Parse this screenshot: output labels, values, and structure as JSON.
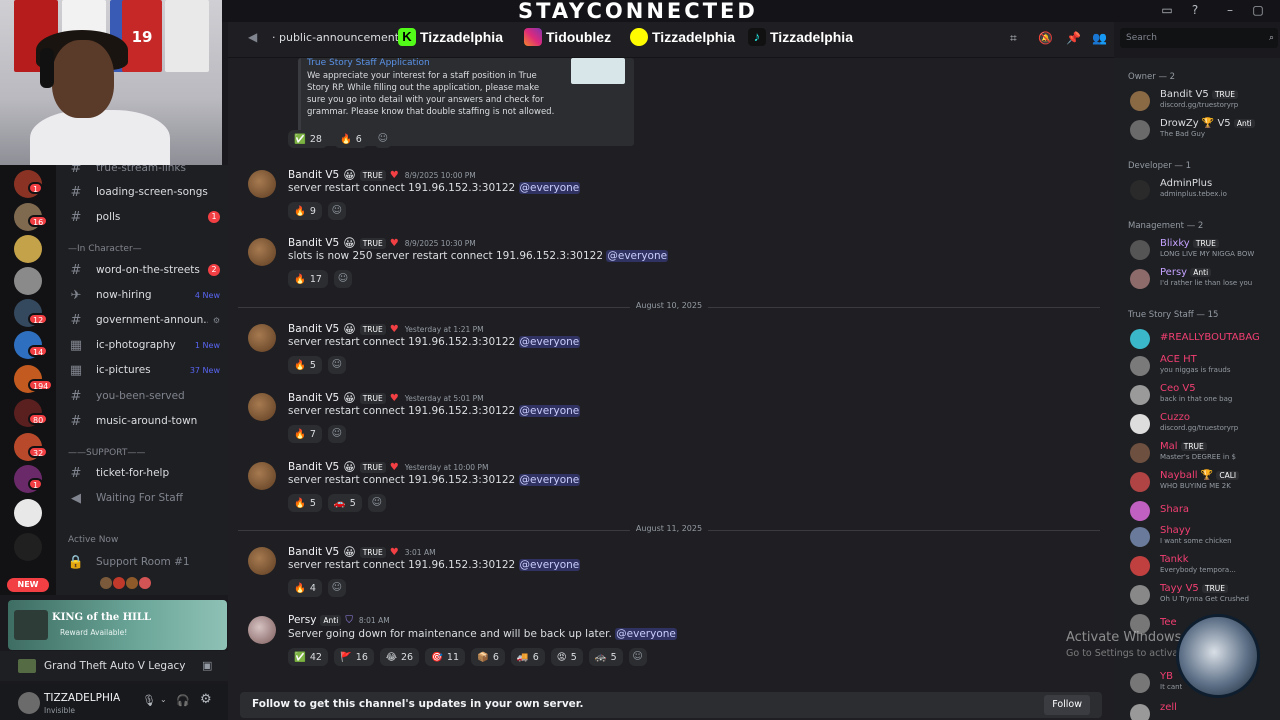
{
  "overlay": {
    "brand_title": "STAYCONNECTED",
    "jersey_numbers": [
      "",
      "",
      "",
      "19",
      ""
    ]
  },
  "server_rail": {
    "badges": [
      "1",
      "16",
      "",
      "",
      "12",
      "14",
      "194",
      "80",
      "32",
      "1"
    ],
    "new_pill": "NEW"
  },
  "channels": {
    "top_partial": "true-stream-links",
    "items": [
      {
        "name": "loading-screen-songs",
        "badge": "",
        "new": ""
      },
      {
        "name": "polls",
        "badge": "1",
        "new": ""
      }
    ],
    "category_in_character": "In Character",
    "in_character": [
      {
        "name": "word-on-the-streets",
        "badge": "2",
        "new": ""
      },
      {
        "name": "now-hiring",
        "badge": "",
        "new": "4 New"
      },
      {
        "name": "government-announ...",
        "badge": "",
        "new": ""
      },
      {
        "name": "ic-photography",
        "badge": "",
        "new": "1 New"
      },
      {
        "name": "ic-pictures",
        "badge": "",
        "new": "37 New"
      },
      {
        "name": "you-been-served",
        "badge": "",
        "new": ""
      },
      {
        "name": "music-around-town",
        "badge": "",
        "new": ""
      }
    ],
    "category_support": "SUPPORT",
    "support": [
      {
        "name": "ticket-for-help"
      },
      {
        "name": "Waiting For Staff"
      }
    ],
    "active_now_label": "Active Now",
    "voice_room": "Support Room #1"
  },
  "activity": {
    "title": "KING of the HILL",
    "subtitle": "Reward Available!",
    "game": "Grand Theft Auto V Legacy",
    "user_name": "TIZZADELPHIA",
    "user_status": "Invisible"
  },
  "header": {
    "channel": "public-announcements",
    "social": [
      {
        "platform": "kick",
        "handle": "Tizzadelphia",
        "color": "#53fc18"
      },
      {
        "platform": "instagram",
        "handle": "Tidoublez",
        "color": "#e1306c"
      },
      {
        "platform": "snapchat",
        "handle": "Tizzadelphia",
        "color": "#fffc00"
      },
      {
        "platform": "tiktok",
        "handle": "Tizzadelphia",
        "color": "#25f4ee"
      }
    ],
    "search_placeholder": "Search"
  },
  "embed": {
    "title": "True Story Staff Application",
    "body": "We appreciate your interest for a staff position in True Story RP. While filling out the application, please make sure you go into detail with your answers and check for grammar. Please know that double staffing is not allowed.",
    "reactions": [
      {
        "emoji": "✅",
        "count": "28"
      },
      {
        "emoji": "🔥",
        "count": "6"
      }
    ]
  },
  "messages": [
    {
      "author": "Bandit V5",
      "tag": "TRUE",
      "time": "8/9/2025 10:00 PM",
      "text": "server restart connect 191.96.152.3:30122",
      "mention": "@everyone",
      "reactions": [
        {
          "emoji": "🔥",
          "count": "9"
        }
      ]
    },
    {
      "author": "Bandit V5",
      "tag": "TRUE",
      "time": "8/9/2025 10:30 PM",
      "text": "slots is now 250 server restart connect 191.96.152.3:30122",
      "mention": "@everyone",
      "reactions": [
        {
          "emoji": "🔥",
          "count": "17"
        }
      ]
    },
    {
      "author": "Bandit V5",
      "tag": "TRUE",
      "time": "Yesterday at 1:21 PM",
      "text": "server restart connect 191.96.152.3:30122",
      "mention": "@everyone",
      "reactions": [
        {
          "emoji": "🔥",
          "count": "5"
        }
      ]
    },
    {
      "author": "Bandit V5",
      "tag": "TRUE",
      "time": "Yesterday at 5:01 PM",
      "text": "server restart connect 191.96.152.3:30122",
      "mention": "@everyone",
      "reactions": [
        {
          "emoji": "🔥",
          "count": "7"
        }
      ]
    },
    {
      "author": "Bandit V5",
      "tag": "TRUE",
      "time": "Yesterday at 10:00 PM",
      "text": "server restart connect 191.96.152.3:30122",
      "mention": "@everyone",
      "reactions": [
        {
          "emoji": "🔥",
          "count": "5"
        },
        {
          "emoji": "🚗",
          "count": "5"
        }
      ]
    },
    {
      "author": "Bandit V5",
      "tag": "TRUE",
      "time": "3:01 AM",
      "text": "server restart connect 191.96.152.3:30122",
      "mention": "@everyone",
      "reactions": [
        {
          "emoji": "🔥",
          "count": "4"
        }
      ]
    },
    {
      "author": "Persy",
      "tag": "Anti",
      "time": "8:01 AM",
      "text": "Server going down for maintenance and will be back up later.",
      "mention": "@everyone",
      "reactions": [
        {
          "emoji": "✅",
          "count": "42"
        },
        {
          "emoji": "🚩",
          "count": "16"
        },
        {
          "emoji": "😂",
          "count": "26"
        },
        {
          "emoji": "🎯",
          "count": "11"
        },
        {
          "emoji": "📦",
          "count": "6"
        },
        {
          "emoji": "🚚",
          "count": "6"
        },
        {
          "emoji": "😡",
          "count": "5"
        },
        {
          "emoji": "🚓",
          "count": "5"
        }
      ]
    }
  ],
  "dividers": [
    "August 10, 2025",
    "August 11, 2025"
  ],
  "follow_bar": {
    "text": "Follow to get this channel's updates in your own server.",
    "button": "Follow"
  },
  "members": {
    "groups": [
      {
        "title": "Owner — 2",
        "members": [
          {
            "name": "Bandit V5",
            "tag": "TRUE",
            "status": "discord.gg/truestoryrp",
            "color": "#ffffff"
          },
          {
            "name": "DrowZy 🏆 V5",
            "tag": "Anti",
            "status": "The Bad Guy",
            "color": "#ffffff"
          }
        ]
      },
      {
        "title": "Developer — 1",
        "members": [
          {
            "name": "AdminPlus",
            "tag": "",
            "status": "adminplus.tebex.io",
            "color": "#ffffff"
          }
        ]
      },
      {
        "title": "Management — 2",
        "members": [
          {
            "name": "Blixky",
            "tag": "TRUE",
            "status": "LONG LIVE MY NIGGA BOW",
            "color": "#c4a2ff"
          },
          {
            "name": "Persy",
            "tag": "Anti",
            "status": "I'd rather lie than lose you",
            "color": "#c4a2ff"
          }
        ]
      },
      {
        "title": "True Story Staff — 15",
        "members": [
          {
            "name": "#REALLYBOUTABAG",
            "tag": "",
            "status": "",
            "color": "#f23f73"
          },
          {
            "name": "ACE HT",
            "tag": "",
            "status": "you niggas is frauds",
            "color": "#f23f73"
          },
          {
            "name": "Ceo V5",
            "tag": "",
            "status": "back in that one bag",
            "color": "#f23f73"
          },
          {
            "name": "Cuzzo",
            "tag": "",
            "status": "discord.gg/truestoryrp",
            "color": "#f23f73"
          },
          {
            "name": "Mal",
            "tag": "TRUE",
            "status": "Master's DEGREE in $",
            "color": "#f23f73"
          },
          {
            "name": "Nayball 🏆",
            "tag": "CALI",
            "status": "WHO BUYING ME 2K",
            "color": "#f23f73"
          },
          {
            "name": "Shara",
            "tag": "",
            "status": "",
            "color": "#f23f73"
          },
          {
            "name": "Shayy",
            "tag": "",
            "status": "I want some chicken",
            "color": "#f23f73"
          },
          {
            "name": "Tankk",
            "tag": "",
            "status": "Everybody tempora...",
            "color": "#f23f73"
          },
          {
            "name": "Tayy V5",
            "tag": "TRUE",
            "status": "Oh U Trynna Get Crushed",
            "color": "#f23f73"
          },
          {
            "name": "Tee",
            "tag": "",
            "status": "",
            "color": "#f23f73"
          },
          {
            "name": "YB",
            "tag": "",
            "status": "It cant",
            "color": "#f23f73"
          },
          {
            "name": "zell",
            "tag": "",
            "status": "",
            "color": "#f23f73"
          }
        ]
      }
    ]
  },
  "watermark": {
    "line1": "Activate Windows",
    "line2": "Go to Settings to activate Windows."
  }
}
